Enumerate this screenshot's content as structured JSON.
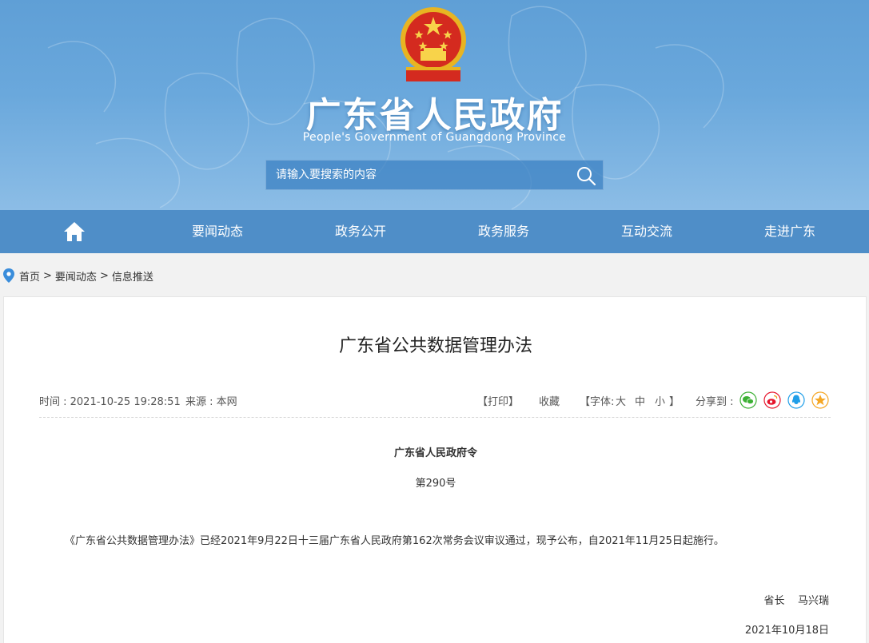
{
  "header": {
    "title": "广东省人民政府",
    "subtitle": "People's Government of Guangdong Province",
    "search_placeholder": "请输入要搜索的内容"
  },
  "nav": {
    "items": [
      "要闻动态",
      "政务公开",
      "政务服务",
      "互动交流",
      "走进广东"
    ]
  },
  "breadcrumb": {
    "items": [
      "首页",
      "要闻动态",
      "信息推送"
    ],
    "separator": ">"
  },
  "article": {
    "title": "广东省公共数据管理办法",
    "time": "时间 : 2021-10-25 19:28:51",
    "source": "来源 : 本网",
    "tools": {
      "print": "【打印】",
      "favorite": "收藏",
      "font_prefix": "【字体:",
      "font_large": "大",
      "font_medium": "中",
      "font_small": "小",
      "font_suffix": "】",
      "share_label": "分享到 :"
    },
    "order_title": "广东省人民政府令",
    "order_number": "第290号",
    "body": "《广东省公共数据管理办法》已经2021年9月22日十三届广东省人民政府第162次常务会议审议通过，现予公布，自2021年11月25日起施行。",
    "signer": "省长    马兴瑞",
    "date": "2021年10月18日"
  },
  "colors": {
    "nav_bg": "#4f8ec8",
    "wechat": "#3cb034",
    "weibo": "#e6162d",
    "qq": "#1f9ee8",
    "qzone": "#f5a623"
  }
}
